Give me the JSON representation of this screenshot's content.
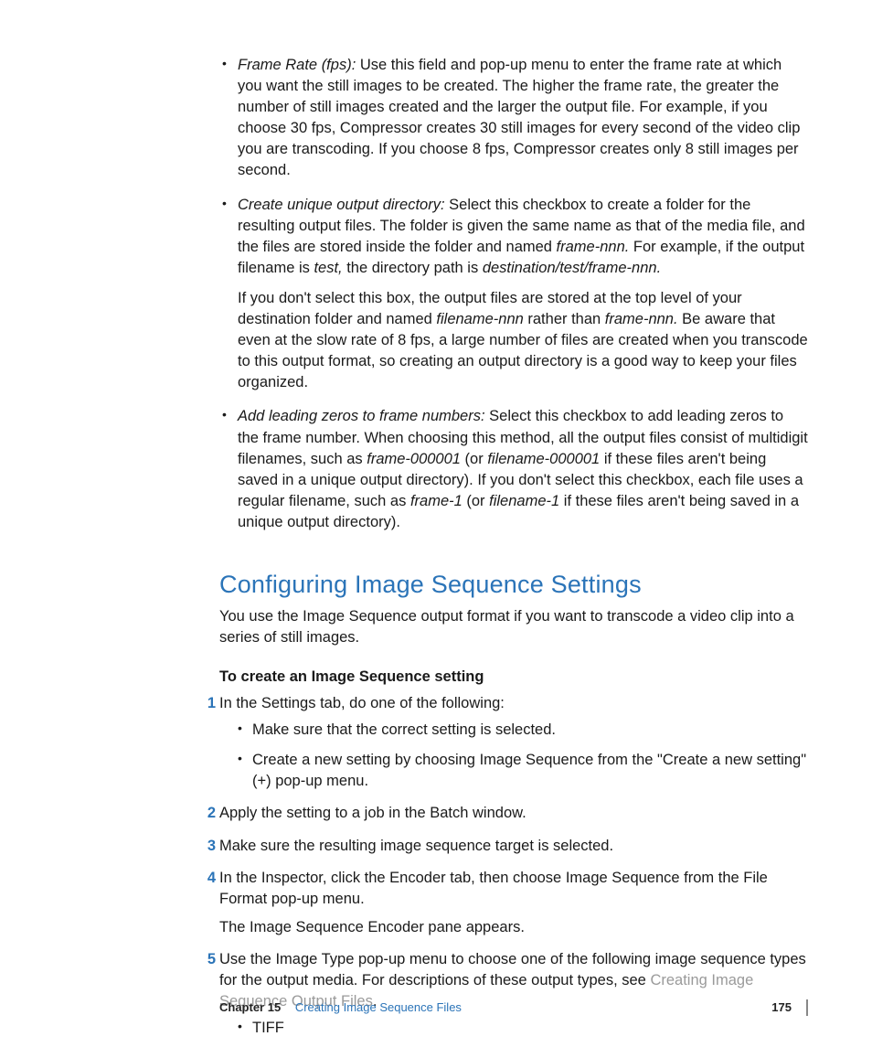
{
  "bullets": {
    "b1": {
      "term": "Frame Rate (fps):",
      "text": "  Use this field and pop-up menu to enter the frame rate at which you want the still images to be created. The higher the frame rate, the greater the number of still images created and the larger the output file. For example, if you choose 30 fps, Compressor creates 30 still images for every second of the video clip you are transcoding. If you choose 8 fps, Compressor creates only 8 still images per second."
    },
    "b2": {
      "term": "Create unique output directory:",
      "t1": "  Select this checkbox to create a folder for the resulting output files. The folder is given the same name as that of the media file, and the files are stored inside the folder and named ",
      "i1": "frame-nnn.",
      "t2": " For example, if the output filename is ",
      "i2": "test,",
      "t3": " the directory path is ",
      "i3": "destination/test/frame-nnn.",
      "p2a": "If you don't select this box, the output files are stored at the top level of your destination folder and named ",
      "p2i1": "filename-nnn",
      "p2b": " rather than ",
      "p2i2": "frame-nnn.",
      "p2c": " Be aware that even at the slow rate of 8 fps, a large number of files are created when you transcode to this output format, so creating an output directory is a good way to keep your files organized."
    },
    "b3": {
      "term": "Add leading zeros to frame numbers:",
      "t1": "  Select this checkbox to add leading zeros to the frame number. When choosing this method, all the output files consist of multidigit filenames, such as ",
      "i1": "frame-000001",
      "t2": " (or ",
      "i2": "filename-000001",
      "t3": " if these files aren't being saved in a unique output directory). If you don't select this checkbox, each file uses a regular filename, such as ",
      "i3": "frame-1",
      "t4": " (or ",
      "i4": "filename-1",
      "t5": " if these files aren't being saved in a unique output directory)."
    }
  },
  "section": {
    "heading": "Configuring Image Sequence Settings",
    "intro": "You use the Image Sequence output format if you want to transcode a video clip into a series of still images.",
    "task_title": "To create an Image Sequence setting"
  },
  "steps": {
    "s1": "In the Settings tab, do one of the following:",
    "s1a": "Make sure that the correct setting is selected.",
    "s1b": "Create a new setting by choosing Image Sequence from the \"Create a new setting\" (+) pop-up menu.",
    "s2": "Apply the setting to a job in the Batch window.",
    "s3": "Make sure the resulting image sequence target is selected.",
    "s4": "In the Inspector, click the Encoder tab, then choose Image Sequence from the File Format pop-up menu.",
    "s4b": "The Image Sequence Encoder pane appears.",
    "s5a": "Use the Image Type pop-up menu to choose one of the following image sequence types for the output media. For descriptions of these output types, see ",
    "s5link": "Creating Image Sequence Output Files",
    "s5b": ".",
    "s5sub1": "TIFF"
  },
  "footer": {
    "chapter_label": "Chapter 15",
    "chapter_title": "Creating Image Sequence Files",
    "page": "175"
  }
}
